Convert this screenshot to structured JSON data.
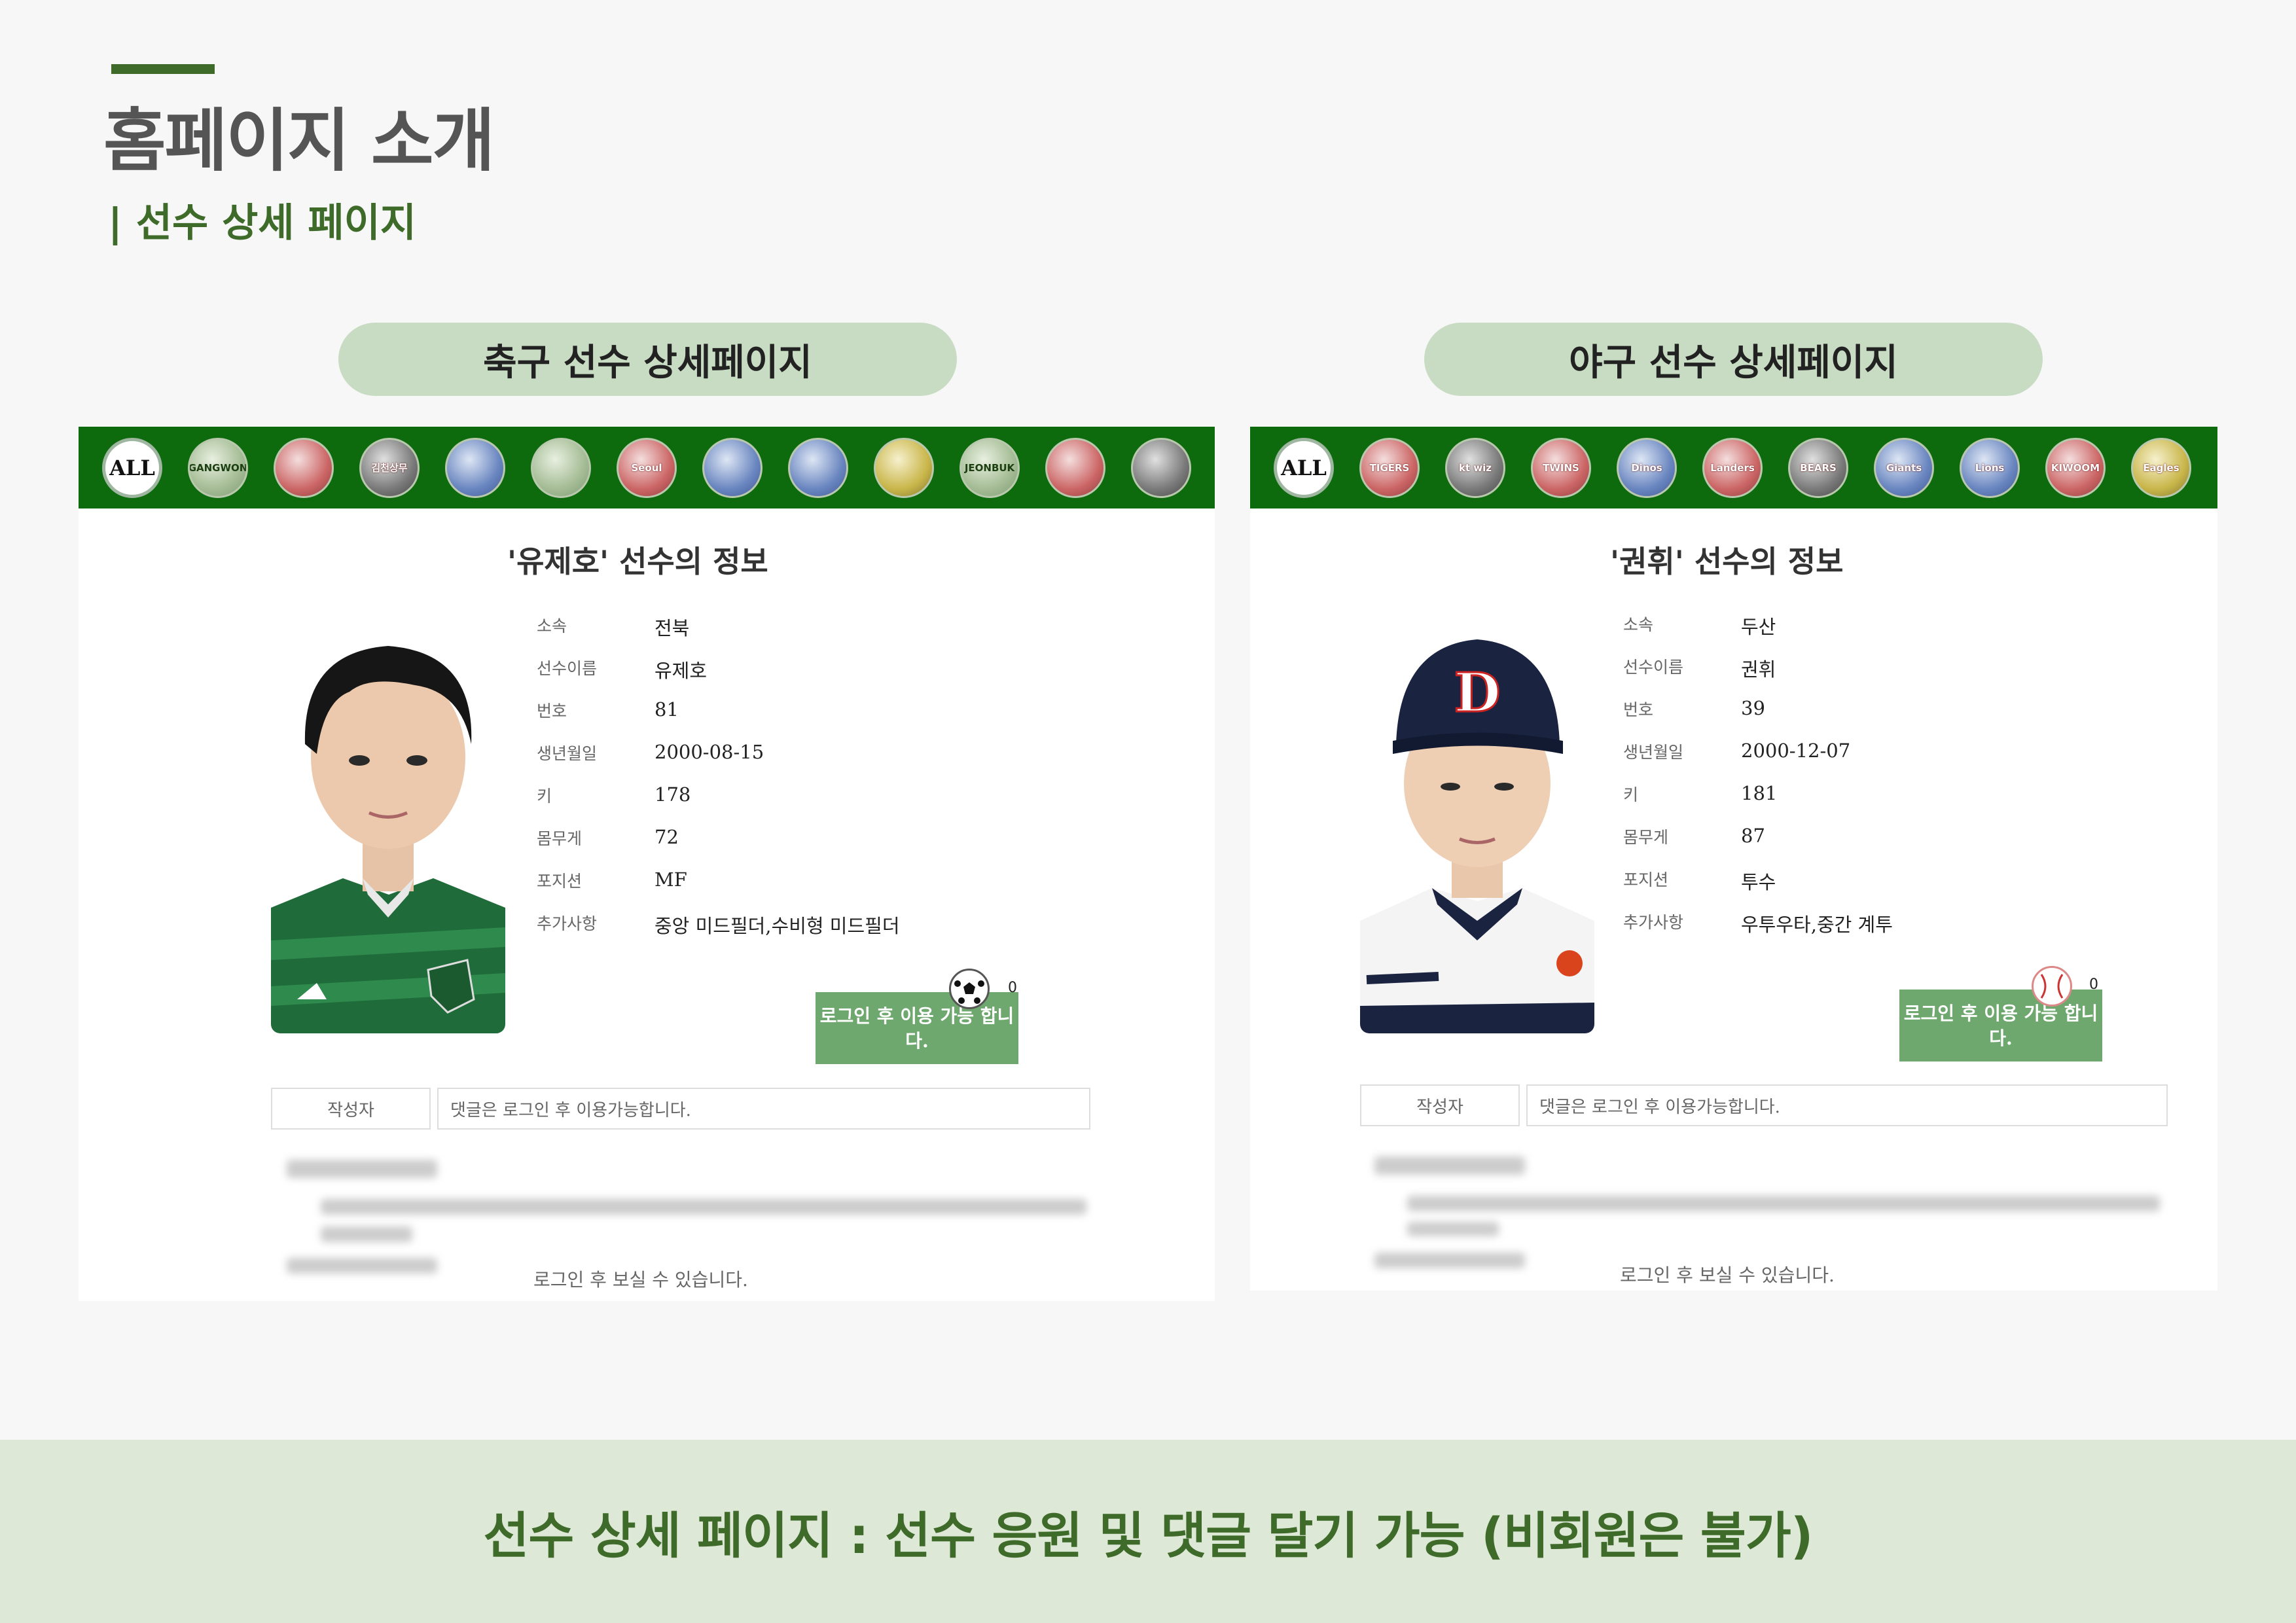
{
  "header": {
    "title": "홈페이지 소개",
    "subtitle": "| 선수 상세 페이지"
  },
  "sections": {
    "soccer_label": "축구 선수 상세페이지",
    "baseball_label": "야구 선수 상세페이지"
  },
  "soccer": {
    "teams": [
      "ALL",
      "GANGWON",
      "",
      "김천상무",
      "",
      "",
      "Seoul",
      "",
      "",
      "",
      "JEONBUK",
      "",
      ""
    ],
    "info_title": "'유제호' 선수의 정보",
    "fields": [
      {
        "label": "소속",
        "value": "전북"
      },
      {
        "label": "선수이름",
        "value": "유제호"
      },
      {
        "label": "번호",
        "value": "81"
      },
      {
        "label": "생년월일",
        "value": "2000-08-15"
      },
      {
        "label": "키",
        "value": "178"
      },
      {
        "label": "몸무게",
        "value": "72"
      },
      {
        "label": "포지션",
        "value": "MF"
      },
      {
        "label": "추가사항",
        "value": "중앙 미드필더,수비형 미드필더"
      }
    ],
    "cheer_count": "0",
    "login_button": "로그인 후 이용 가능 합니다.",
    "writer_label": "작성자",
    "comment_placeholder": "댓글은 로그인 후 이용가능합니다.",
    "blur_note": "로그인 후 보실 수 있습니다."
  },
  "baseball": {
    "teams": [
      "ALL",
      "TIGERS",
      "kt wiz",
      "TWINS",
      "Dinos",
      "Landers",
      "BEARS",
      "Giants",
      "Lions",
      "KIWOOM",
      "Eagles"
    ],
    "info_title": "'권휘' 선수의 정보",
    "fields": [
      {
        "label": "소속",
        "value": "두산"
      },
      {
        "label": "선수이름",
        "value": "권휘"
      },
      {
        "label": "번호",
        "value": "39"
      },
      {
        "label": "생년월일",
        "value": "2000-12-07"
      },
      {
        "label": "키",
        "value": "181"
      },
      {
        "label": "몸무게",
        "value": "87"
      },
      {
        "label": "포지션",
        "value": "투수"
      },
      {
        "label": "추가사항",
        "value": "우투우타,중간 계투"
      }
    ],
    "cheer_count": "0",
    "login_button": "로그인 후 이용 가능 합니다.",
    "writer_label": "작성자",
    "comment_placeholder": "댓글은 로그인 후 이용가능합니다.",
    "blur_note": "로그인 후 보실 수 있습니다."
  },
  "footer": {
    "caption": "선수 상세 페이지 : 선수 응원 및 댓글 달기 가능 (비회원은 불가)"
  }
}
